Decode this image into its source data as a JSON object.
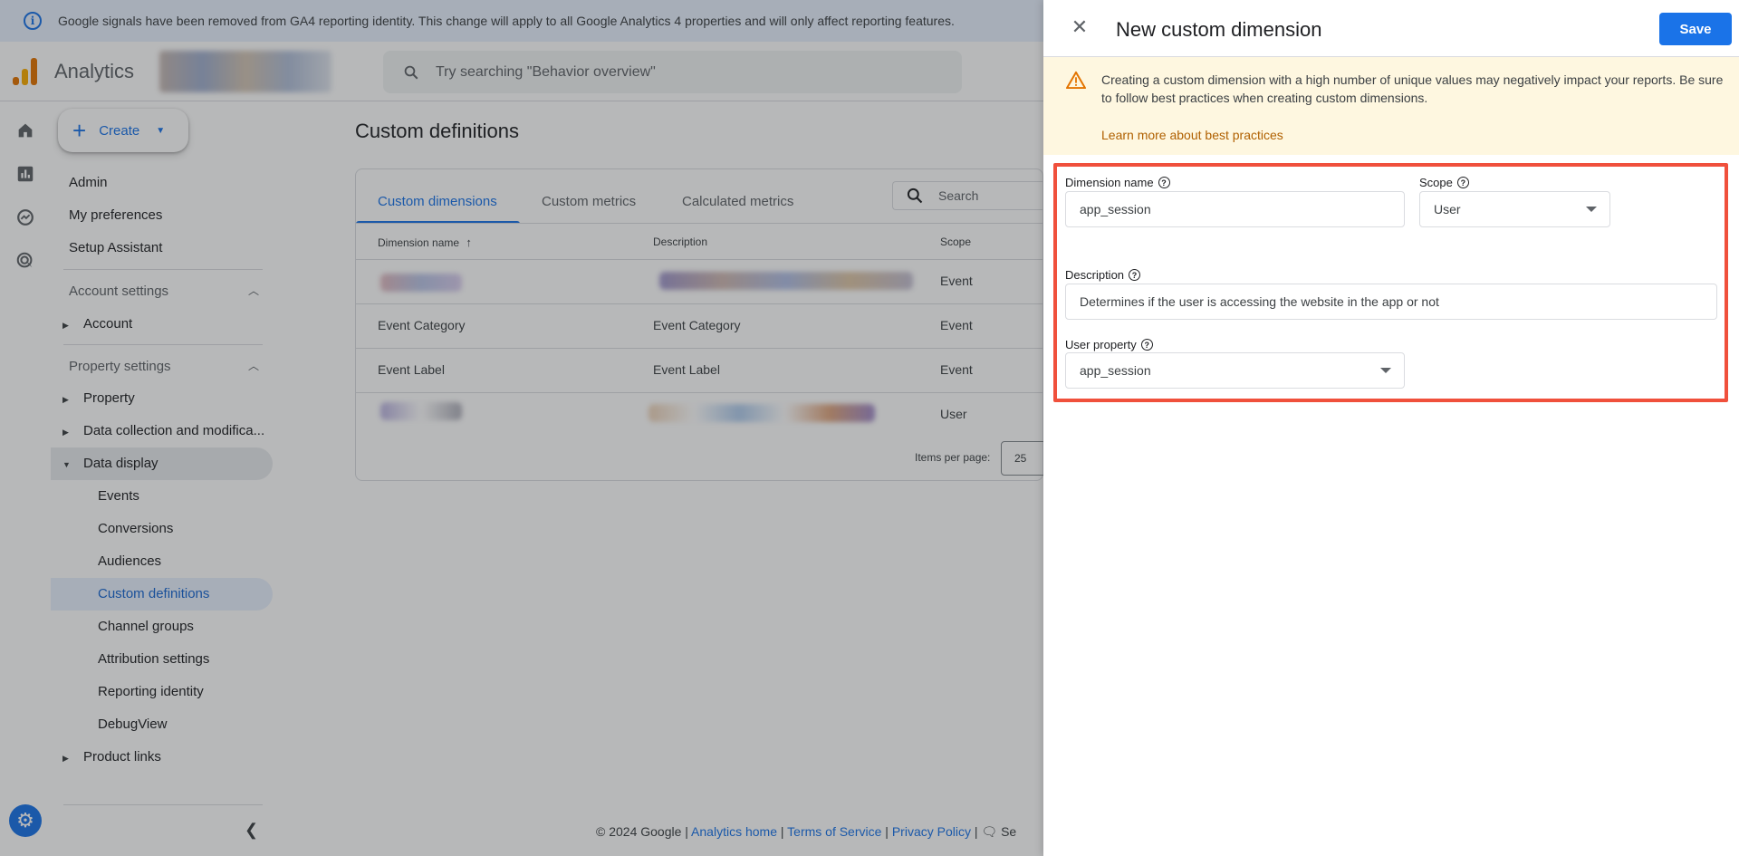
{
  "banner": {
    "text": "Google signals have been removed from GA4 reporting identity. This change will apply to all Google Analytics 4 properties and will only affect reporting features."
  },
  "header": {
    "brand": "Analytics",
    "search_placeholder": "Try searching \"Behavior overview\""
  },
  "create": {
    "label": "Create"
  },
  "nav": {
    "admin": "Admin",
    "my_preferences": "My preferences",
    "setup_assistant": "Setup Assistant",
    "account_settings": "Account settings",
    "account": "Account",
    "property_settings": "Property settings",
    "property": "Property",
    "data_collection": "Data collection and modifica...",
    "data_display": "Data display",
    "events": "Events",
    "conversions": "Conversions",
    "audiences": "Audiences",
    "custom_definitions": "Custom definitions",
    "channel_groups": "Channel groups",
    "attribution_settings": "Attribution settings",
    "reporting_identity": "Reporting identity",
    "debugview": "DebugView",
    "product_links": "Product links"
  },
  "main": {
    "title": "Custom definitions",
    "tabs": [
      "Custom dimensions",
      "Custom metrics",
      "Calculated metrics"
    ],
    "search_placeholder": "Search",
    "columns": [
      "Dimension name",
      "Description",
      "Scope"
    ],
    "rows": [
      {
        "name": "",
        "description": "",
        "scope": "Event"
      },
      {
        "name": "Event Category",
        "description": "Event Category",
        "scope": "Event"
      },
      {
        "name": "Event Label",
        "description": "Event Label",
        "scope": "Event"
      },
      {
        "name": "",
        "description": "",
        "scope": "User"
      }
    ],
    "items_per_page_label": "Items per page:",
    "items_per_page_value": "25"
  },
  "footer": {
    "copyright": "© 2024 Google |",
    "analytics_home": "Analytics home",
    "terms": "Terms of Service",
    "privacy": "Privacy Policy",
    "sep": "|",
    "feedback": "Se"
  },
  "drawer": {
    "title": "New custom dimension",
    "save_label": "Save",
    "warning_text": "Creating a custom dimension with a high number of unique values may negatively impact your reports. Be sure to follow best practices when creating custom dimensions.",
    "warning_link": "Learn more about best practices",
    "dimension_name_label": "Dimension name",
    "dimension_name_value": "app_session",
    "scope_label": "Scope",
    "scope_value": "User",
    "description_label": "Description",
    "description_value": "Determines if the user is accessing the website in the app or not",
    "user_property_label": "User property",
    "user_property_value": "app_session"
  },
  "colors": {
    "accent": "#1a73e8",
    "warning_bg": "#fef7e0",
    "warning_link": "#b06000",
    "highlight": "#f0503c"
  },
  "icons": [
    "info-icon",
    "analytics-logo-icon",
    "search-icon",
    "home-icon",
    "reports-icon",
    "explore-icon",
    "advertising-icon",
    "plus-icon",
    "gear-icon",
    "close-icon",
    "warning-icon",
    "help-icon",
    "sort-arrow-icon",
    "chevron-left-icon"
  ]
}
